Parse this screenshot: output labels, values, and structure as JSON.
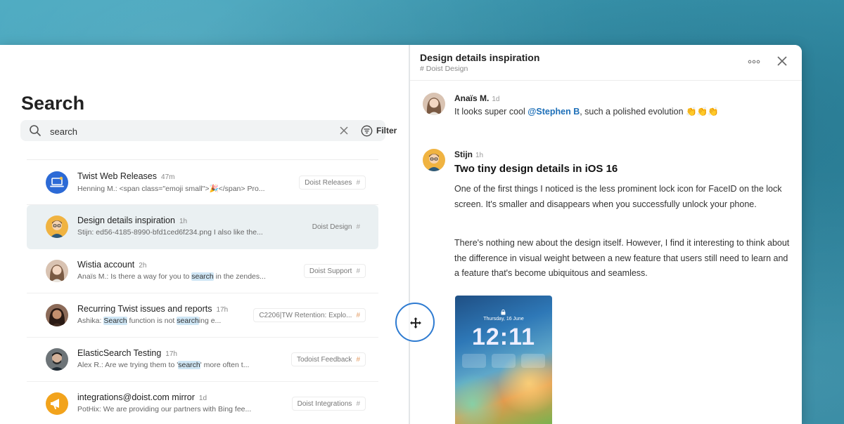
{
  "search": {
    "title": "Search",
    "query": "search",
    "filter_label": "Filter"
  },
  "results": [
    {
      "title": "Twist Web Releases",
      "time": "47m",
      "snippet": "Henning M.: <span class=\"emoji small\">🎉</span> Pro...",
      "channel": "Doist Releases",
      "avatar_color": "#2c6ad6",
      "selected": false
    },
    {
      "title": "Design details inspiration",
      "time": "1h",
      "snippet": "Stijn: ed56-4185-8990-bfd1ced6f234.png I also like the...",
      "channel": "Doist Design",
      "avatar_color": "#f0b341",
      "selected": true
    },
    {
      "title": "Wistia account",
      "time": "2h",
      "snippet_pre": "Anaïs M.: Is there a way for you to ",
      "snippet_hl": "search",
      "snippet_post": " in the zendes...",
      "channel": "Doist Support",
      "avatar_color": "#c9a38a",
      "selected": false
    },
    {
      "title": "Recurring Twist issues and reports",
      "time": "17h",
      "snippet_pre": "Ashika: ",
      "snippet_hl": "Search",
      "snippet_mid": " function is not ",
      "snippet_hl2": "search",
      "snippet_post": "ing e...",
      "channel": "C2206|TW Retention: Explo...",
      "avatar_color": "#5a3b2d",
      "selected": false
    },
    {
      "title": "ElasticSearch Testing",
      "time": "17h",
      "snippet_pre": "Alex R.: Are we trying them to '",
      "snippet_hl": "search",
      "snippet_post": "' more often t...",
      "channel": "Todoist Feedback",
      "avatar_color": "#3b3b3b",
      "selected": false
    },
    {
      "title": "integrations@doist.com mirror",
      "time": "1d",
      "snippet": "PotHix: We are providing our partners with Bing fee...",
      "channel": "Doist Integrations",
      "avatar_color": "#f2a31c",
      "selected": false
    }
  ],
  "thread": {
    "title": "Design details inspiration",
    "channel": "# Doist Design",
    "messages": [
      {
        "author": "Anaïs M.",
        "time": "1d",
        "text_pre": "It looks super cool ",
        "mention": "@Stephen B",
        "text_post": ", such a polished evolution 👏👏👏"
      },
      {
        "author": "Stijn",
        "time": "1h",
        "post_title": "Two tiny design details in iOS 16",
        "paragraphs": [
          "One of the first things I noticed is the less prominent lock icon for FaceID on the lock screen. It's smaller and disappears when you successfully unlock your phone.",
          "There's nothing new about the design itself. However, I find it interesting to think about the difference in visual weight between a new feature that users still need to learn and a feature that's become ubiquitous and seamless."
        ]
      }
    ],
    "phone": {
      "date": "Thursday, 16 June",
      "clock": "12:11"
    }
  },
  "colors": {
    "accent": "#1d6fb8",
    "highlight": "#cfe6f5",
    "selected_row": "#eaf0f2",
    "handle": "#2e7bd1"
  }
}
